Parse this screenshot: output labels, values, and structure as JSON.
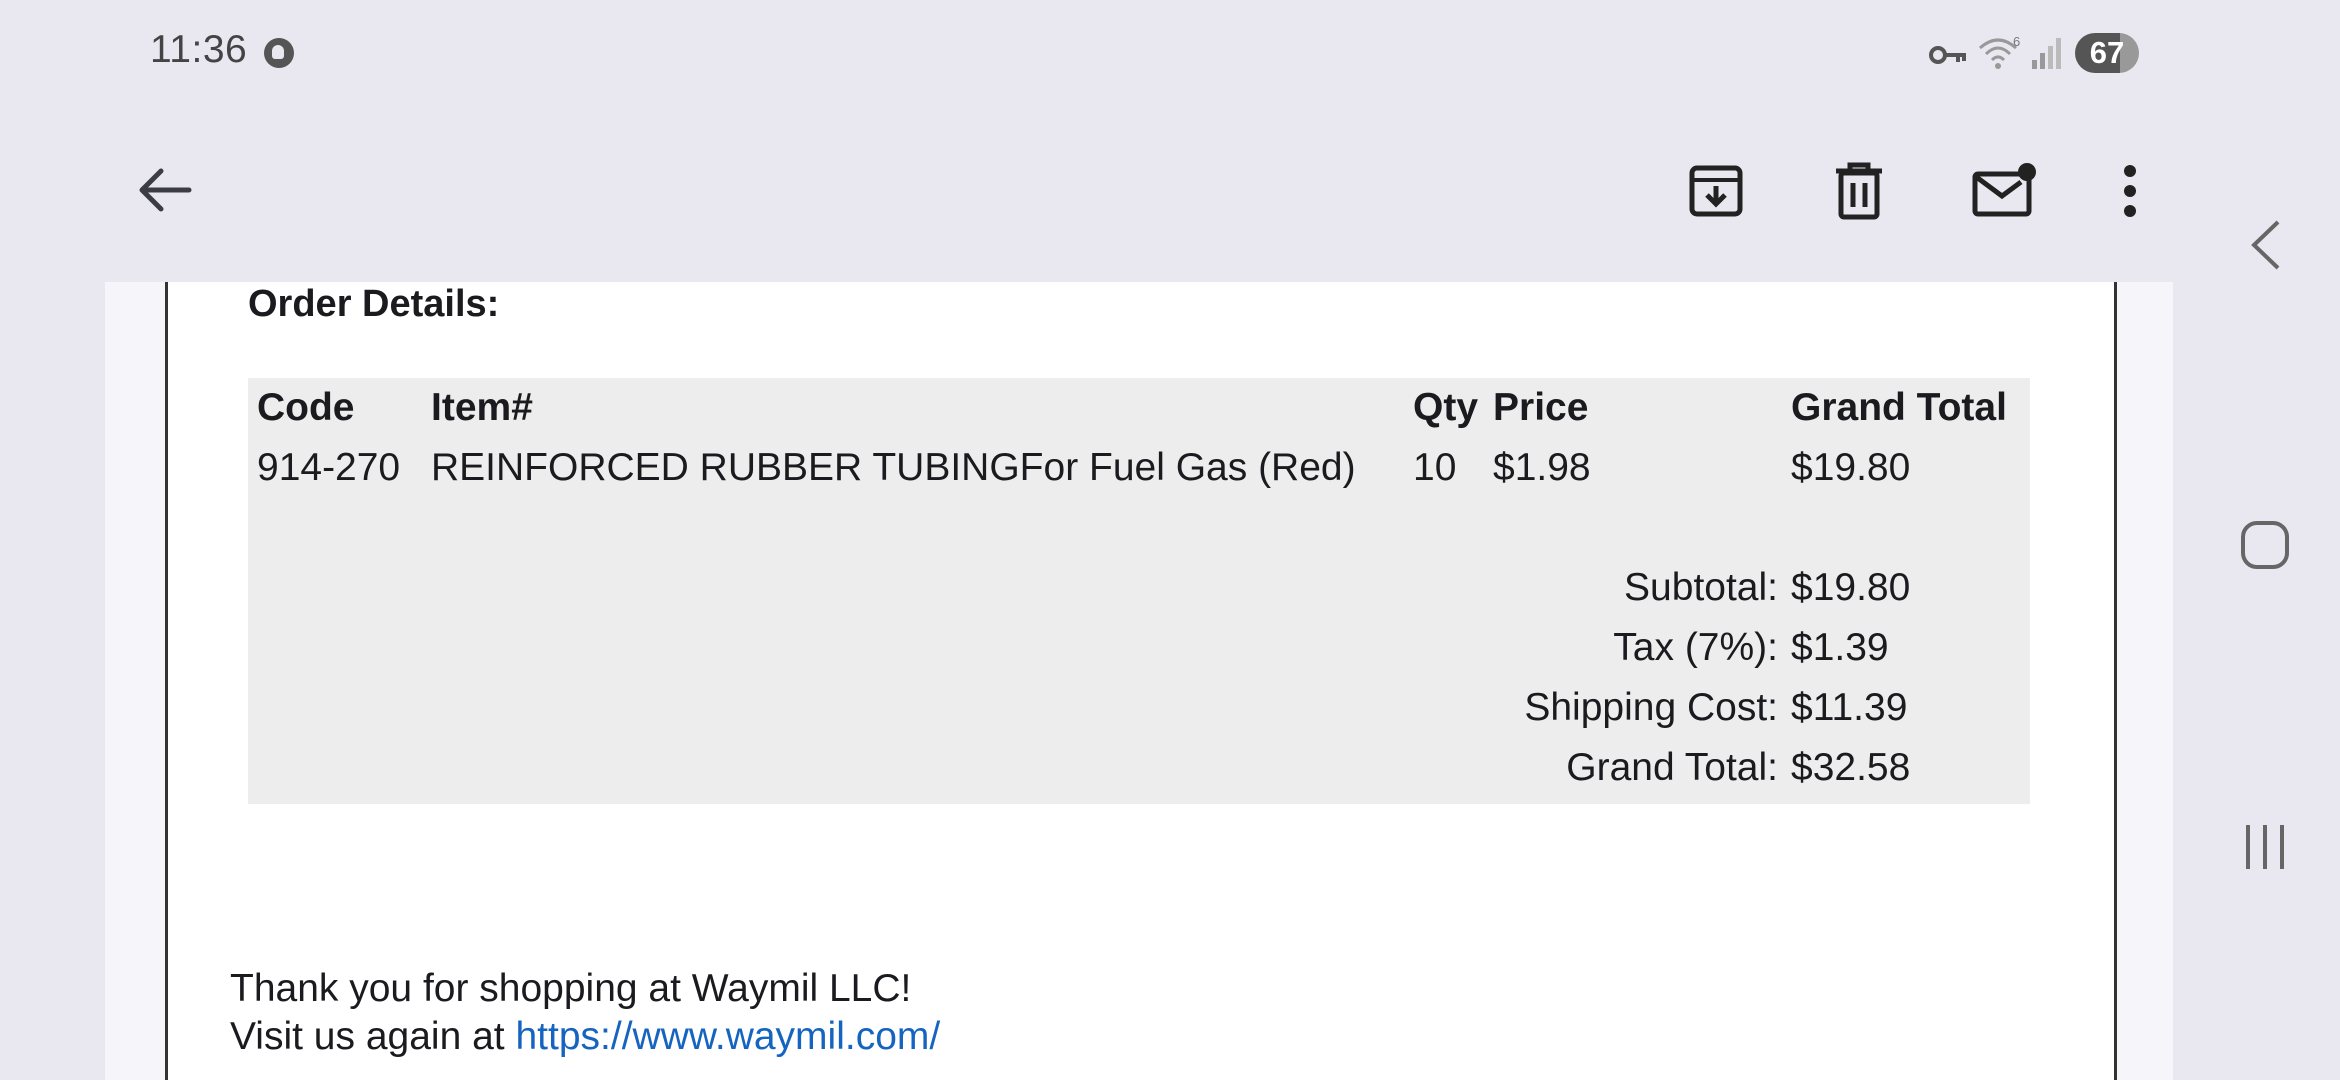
{
  "status_bar": {
    "time": "11:36",
    "battery": "67",
    "icons": [
      "vpn-key-icon",
      "wifi-icon",
      "signal-icon"
    ]
  },
  "app_bar": {
    "icons": [
      "back-arrow-icon",
      "archive-icon",
      "trash-icon",
      "mark-unread-icon",
      "more-vert-icon"
    ]
  },
  "nav": {
    "icons": [
      "back-nav-icon",
      "home-nav-icon",
      "recents-nav-icon"
    ]
  },
  "order": {
    "title": "Order Details:",
    "columns": [
      "Code",
      "Item#",
      "Qty",
      "Price",
      "Grand Total"
    ],
    "rows": [
      {
        "code": "914-270",
        "item": "REINFORCED RUBBER TUBINGFor Fuel Gas (Red)",
        "qty": "10",
        "price": "$1.98",
        "total": "$19.80"
      }
    ],
    "summary": [
      {
        "label": "Subtotal:",
        "value": "$19.80"
      },
      {
        "label": "Tax (7%):",
        "value": "$1.39"
      },
      {
        "label": "Shipping Cost:",
        "value": "$11.39"
      },
      {
        "label": "Grand Total:",
        "value": "$32.58"
      }
    ]
  },
  "footer": {
    "thanks": "Thank you for shopping at Waymil LLC!",
    "visit_prefix": "Visit us again at ",
    "link": "https://www.waymil.com/"
  },
  "colors": {
    "background": "#e9e8f0",
    "table": "#ededed",
    "link": "#1565c0"
  }
}
